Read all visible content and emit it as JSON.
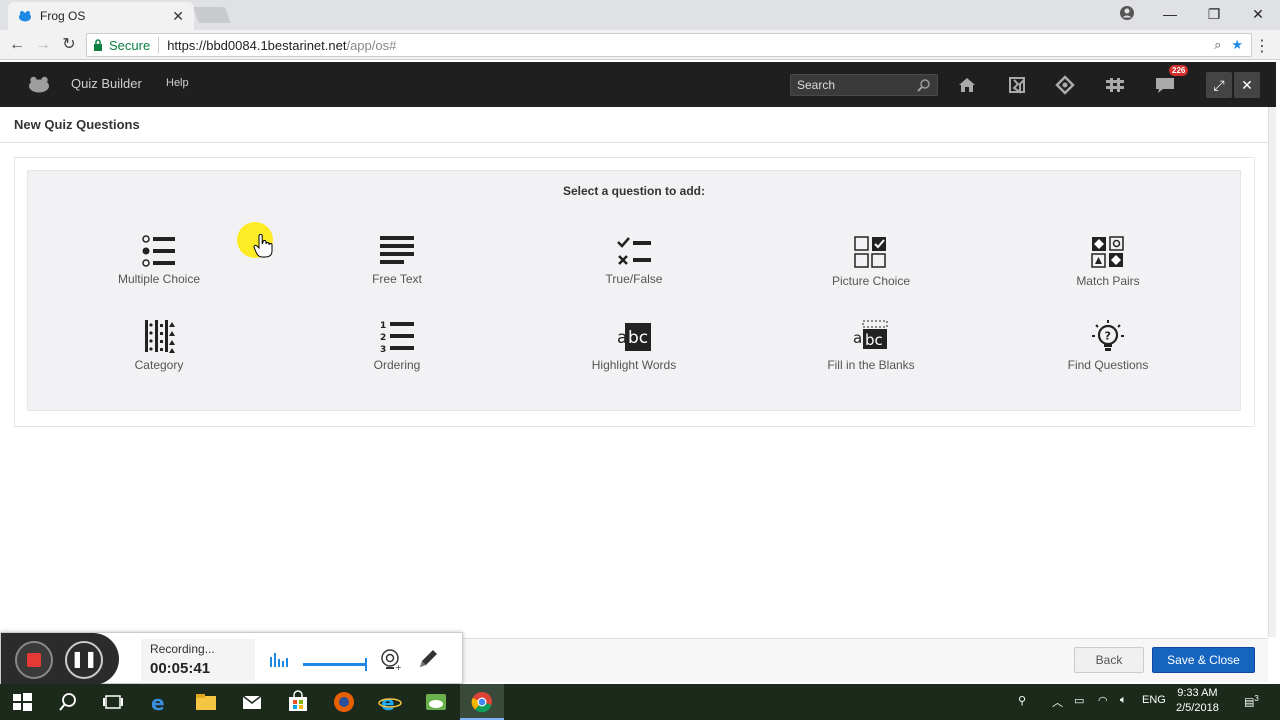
{
  "browser": {
    "tab_title": "Frog OS",
    "secure_label": "Secure",
    "url_host": "https://bbd0084.1bestarinet.net",
    "url_path": "/app/os#"
  },
  "appbar": {
    "menu": [
      "Quiz Builder",
      "Help"
    ],
    "search_placeholder": "Search",
    "notification_count": "226"
  },
  "page": {
    "title": "New Quiz Questions",
    "prompt": "Select a question to add:",
    "question_types": [
      {
        "label": "Multiple Choice",
        "icon": "multiple-choice-icon"
      },
      {
        "label": "Free Text",
        "icon": "free-text-icon"
      },
      {
        "label": "True/False",
        "icon": "true-false-icon"
      },
      {
        "label": "Picture Choice",
        "icon": "picture-choice-icon"
      },
      {
        "label": "Match Pairs",
        "icon": "match-pairs-icon"
      },
      {
        "label": "Category",
        "icon": "category-icon"
      },
      {
        "label": "Ordering",
        "icon": "ordering-icon"
      },
      {
        "label": "Highlight Words",
        "icon": "highlight-words-icon"
      },
      {
        "label": "Fill in the Blanks",
        "icon": "fill-blanks-icon"
      },
      {
        "label": "Find Questions",
        "icon": "find-questions-icon"
      }
    ]
  },
  "footer": {
    "back_label": "Back",
    "save_label": "Save & Close"
  },
  "recorder": {
    "state": "Recording...",
    "elapsed": "00:05:41"
  },
  "taskbar": {
    "language": "ENG",
    "time": "9:33 AM",
    "date": "2/5/2018",
    "notifications": "3"
  },
  "colors": {
    "app_bar": "#1f1f1f",
    "save_button": "#1565c0",
    "badge": "#d32f2f",
    "panel": "#f2f2f4"
  }
}
